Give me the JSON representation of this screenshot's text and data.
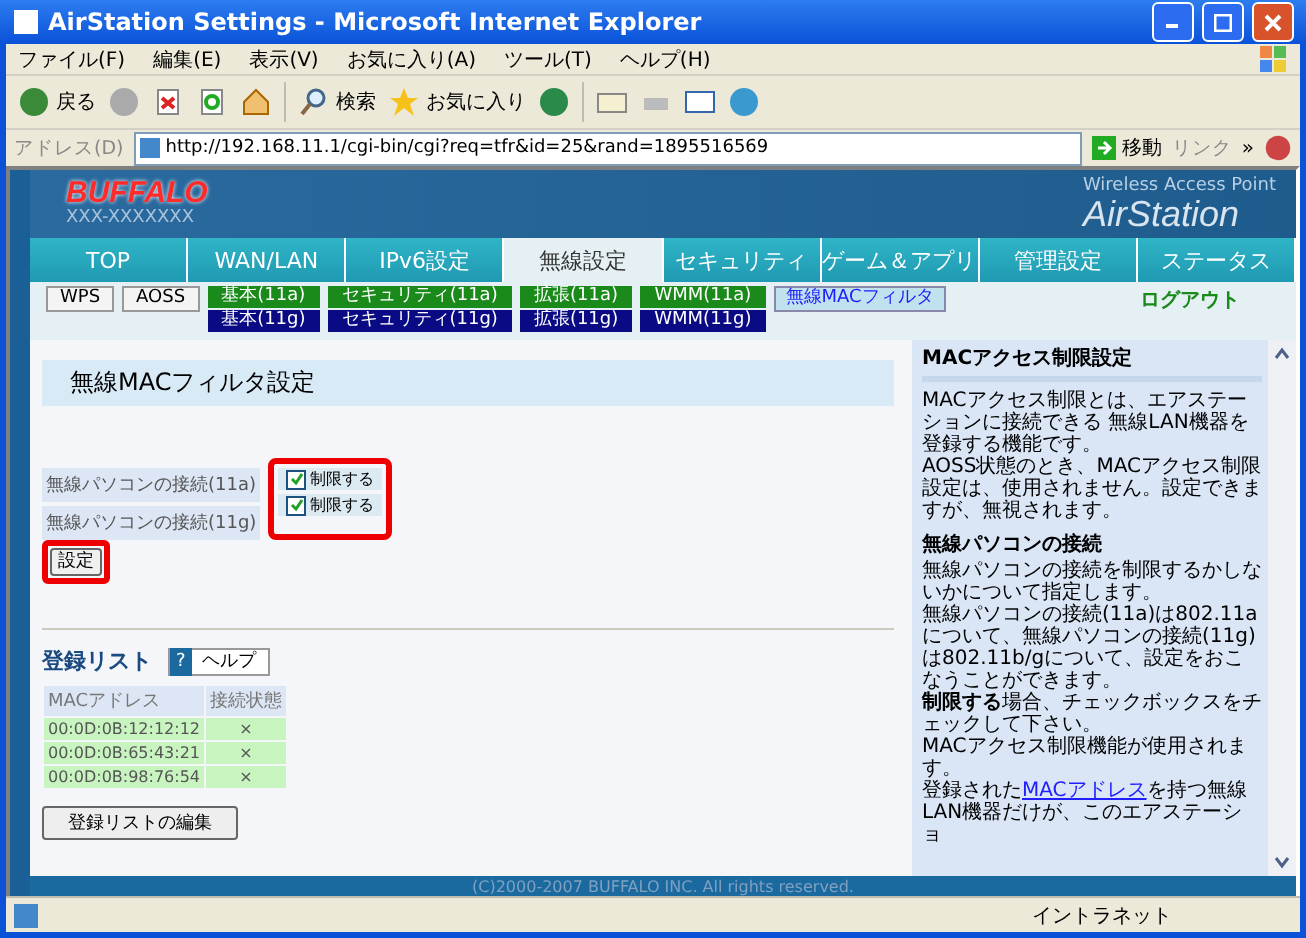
{
  "window": {
    "title": "AirStation Settings - Microsoft Internet Explorer"
  },
  "menu": [
    "ファイル(F)",
    "編集(E)",
    "表示(V)",
    "お気に入り(A)",
    "ツール(T)",
    "ヘルプ(H)"
  ],
  "toolbar": {
    "back": "戻る",
    "search": "検索",
    "favorites": "お気に入り"
  },
  "address": {
    "label": "アドレス(D)",
    "url": "http://192.168.11.1/cgi-bin/cgi?req=tfr&id=25&rand=1895516569",
    "go": "移動",
    "links": "リンク",
    "more": "»"
  },
  "banner": {
    "brand": "BUFFALO",
    "model": "XXX-XXXXXXX",
    "product_caption": "Wireless Access Point",
    "product": "AirStation"
  },
  "tabs": [
    {
      "label": "TOP",
      "selected": false
    },
    {
      "label": "WAN/LAN",
      "selected": false
    },
    {
      "label": "IPv6設定",
      "selected": false
    },
    {
      "label": "無線設定",
      "selected": true
    },
    {
      "label": "セキュリティ",
      "selected": false
    },
    {
      "label": "ゲーム＆アプリ",
      "selected": false
    },
    {
      "label": "管理設定",
      "selected": false
    },
    {
      "label": "ステータス",
      "selected": false
    }
  ],
  "subtabs": {
    "plain": [
      "WPS",
      "AOSS"
    ],
    "columns": [
      {
        "top": "基本(11a)",
        "bottom": "基本(11g)"
      },
      {
        "top": "セキュリティ(11a)",
        "bottom": "セキュリティ(11g)"
      },
      {
        "top": "拡張(11a)",
        "bottom": "拡張(11g)"
      },
      {
        "top": "WMM(11a)",
        "bottom": "WMM(11g)"
      }
    ],
    "current": "無線MACフィルタ",
    "logout": "ログアウト"
  },
  "section_title": "無線MACフィルタ設定",
  "settings": [
    {
      "label": "無線パソコンの接続(11a)",
      "option": "制限する",
      "checked": true
    },
    {
      "label": "無線パソコンの接続(11g)",
      "option": "制限する",
      "checked": true
    }
  ],
  "apply_button": "設定",
  "registry": {
    "title": "登録リスト",
    "help": "ヘルプ",
    "help_icon": "?",
    "columns": [
      "MACアドレス",
      "接続状態"
    ],
    "rows": [
      {
        "mac": "00:0D:0B:12:12:12",
        "status": "×"
      },
      {
        "mac": "00:0D:0B:65:43:21",
        "status": "×"
      },
      {
        "mac": "00:0D:0B:98:76:54",
        "status": "×"
      }
    ],
    "edit_button": "登録リストの編集"
  },
  "help": {
    "title": "MACアクセス制限設定",
    "intro": [
      "MACアクセス制限とは、エアステーションに接続できる 無線LAN機器を登録する機能です。",
      "AOSS状態のとき、MACアクセス制限設定は、使用されません。設定できますが、無視されます。"
    ],
    "heading": "無線パソコンの接続",
    "paragraphs": [
      "無線パソコンの接続を制限するかしないかについて指定します。",
      "無線パソコンの接続(11a)は802.11aについて、無線パソコンの接続(11g)は802.11b/gについて、設定をおこなうことができます。",
      "**制限する**場合、チェックボックスをチェックして下さい。",
      "MACアクセス制限機能が使用されます。"
    ],
    "last": {
      "before": "登録された",
      "link": "MACアドレス",
      "after": "を持つ無線LAN機器だけが、このエアステーショ"
    }
  },
  "footer": "(C)2000-2007 BUFFALO INC. All rights reserved.",
  "status_bar": {
    "zone": "イントラネット"
  }
}
